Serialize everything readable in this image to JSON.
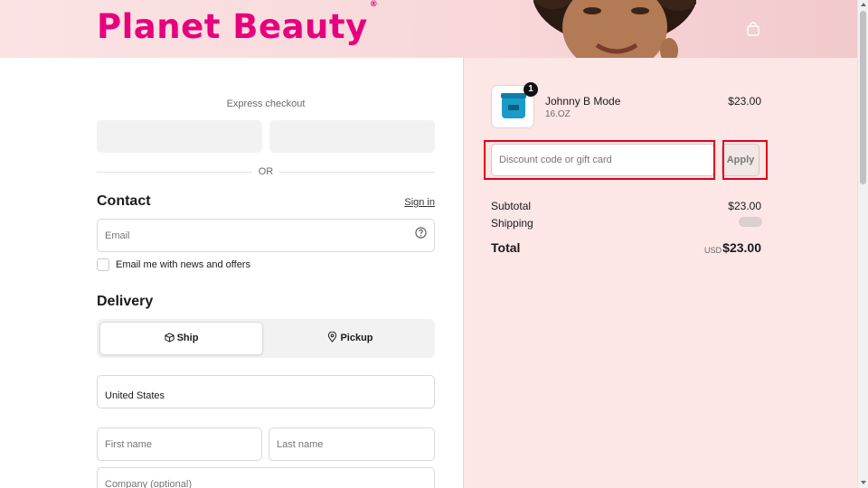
{
  "header": {
    "logo_text": "Planet Beauty",
    "logo_mark": "®",
    "brand_color": "#e6007e",
    "cart_icon": "shopping-bag-icon"
  },
  "checkout": {
    "express_label": "Express checkout",
    "or_label": "OR",
    "contact": {
      "title": "Contact",
      "sign_in_label": "Sign in",
      "email_placeholder": "Email",
      "help_icon": "question-circle-icon",
      "marketing_label": "Email me with news and offers",
      "marketing_checked": false
    },
    "delivery": {
      "title": "Delivery",
      "options": [
        {
          "label": "Ship",
          "icon": "box-icon",
          "selected": true
        },
        {
          "label": "Pickup",
          "icon": "location-pin-icon",
          "selected": false
        }
      ],
      "country_value": "United States",
      "first_name_placeholder": "First name",
      "last_name_placeholder": "Last name",
      "company_placeholder": "Company (optional)"
    }
  },
  "summary": {
    "item": {
      "name": "Johnny B Mode",
      "variant": "16.OZ",
      "price": "$23.00",
      "quantity": "1"
    },
    "discount_placeholder": "Discount code or gift card",
    "apply_label": "Apply",
    "subtotal_label": "Subtotal",
    "subtotal_value": "$23.00",
    "shipping_label": "Shipping",
    "total_label": "Total",
    "currency": "USD",
    "total_value": "$23.00",
    "highlight_color": "#e1001a",
    "panel_color": "#fce6e6"
  }
}
